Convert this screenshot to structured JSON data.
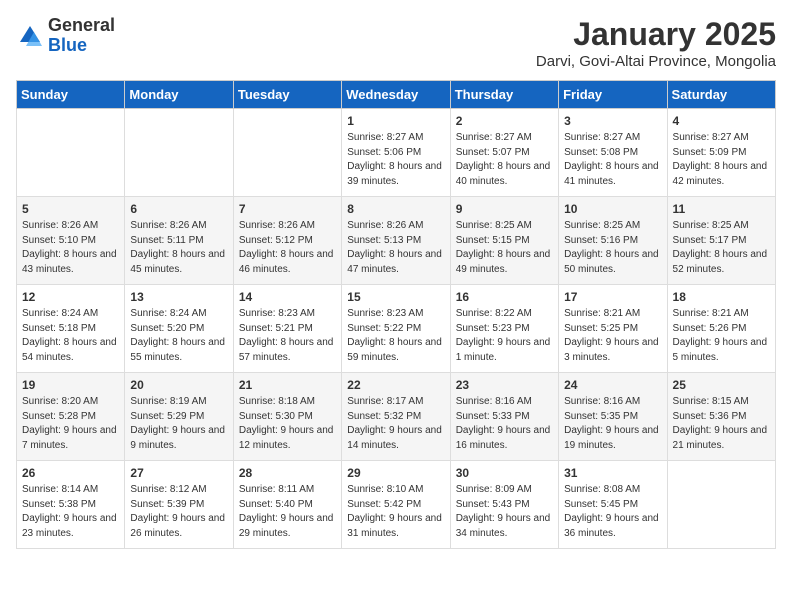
{
  "logo": {
    "general": "General",
    "blue": "Blue"
  },
  "title": "January 2025",
  "location": "Darvi, Govi-Altai Province, Mongolia",
  "headers": [
    "Sunday",
    "Monday",
    "Tuesday",
    "Wednesday",
    "Thursday",
    "Friday",
    "Saturday"
  ],
  "weeks": [
    [
      {
        "day": "",
        "info": ""
      },
      {
        "day": "",
        "info": ""
      },
      {
        "day": "",
        "info": ""
      },
      {
        "day": "1",
        "info": "Sunrise: 8:27 AM\nSunset: 5:06 PM\nDaylight: 8 hours and 39 minutes."
      },
      {
        "day": "2",
        "info": "Sunrise: 8:27 AM\nSunset: 5:07 PM\nDaylight: 8 hours and 40 minutes."
      },
      {
        "day": "3",
        "info": "Sunrise: 8:27 AM\nSunset: 5:08 PM\nDaylight: 8 hours and 41 minutes."
      },
      {
        "day": "4",
        "info": "Sunrise: 8:27 AM\nSunset: 5:09 PM\nDaylight: 8 hours and 42 minutes."
      }
    ],
    [
      {
        "day": "5",
        "info": "Sunrise: 8:26 AM\nSunset: 5:10 PM\nDaylight: 8 hours and 43 minutes."
      },
      {
        "day": "6",
        "info": "Sunrise: 8:26 AM\nSunset: 5:11 PM\nDaylight: 8 hours and 45 minutes."
      },
      {
        "day": "7",
        "info": "Sunrise: 8:26 AM\nSunset: 5:12 PM\nDaylight: 8 hours and 46 minutes."
      },
      {
        "day": "8",
        "info": "Sunrise: 8:26 AM\nSunset: 5:13 PM\nDaylight: 8 hours and 47 minutes."
      },
      {
        "day": "9",
        "info": "Sunrise: 8:25 AM\nSunset: 5:15 PM\nDaylight: 8 hours and 49 minutes."
      },
      {
        "day": "10",
        "info": "Sunrise: 8:25 AM\nSunset: 5:16 PM\nDaylight: 8 hours and 50 minutes."
      },
      {
        "day": "11",
        "info": "Sunrise: 8:25 AM\nSunset: 5:17 PM\nDaylight: 8 hours and 52 minutes."
      }
    ],
    [
      {
        "day": "12",
        "info": "Sunrise: 8:24 AM\nSunset: 5:18 PM\nDaylight: 8 hours and 54 minutes."
      },
      {
        "day": "13",
        "info": "Sunrise: 8:24 AM\nSunset: 5:20 PM\nDaylight: 8 hours and 55 minutes."
      },
      {
        "day": "14",
        "info": "Sunrise: 8:23 AM\nSunset: 5:21 PM\nDaylight: 8 hours and 57 minutes."
      },
      {
        "day": "15",
        "info": "Sunrise: 8:23 AM\nSunset: 5:22 PM\nDaylight: 8 hours and 59 minutes."
      },
      {
        "day": "16",
        "info": "Sunrise: 8:22 AM\nSunset: 5:23 PM\nDaylight: 9 hours and 1 minute."
      },
      {
        "day": "17",
        "info": "Sunrise: 8:21 AM\nSunset: 5:25 PM\nDaylight: 9 hours and 3 minutes."
      },
      {
        "day": "18",
        "info": "Sunrise: 8:21 AM\nSunset: 5:26 PM\nDaylight: 9 hours and 5 minutes."
      }
    ],
    [
      {
        "day": "19",
        "info": "Sunrise: 8:20 AM\nSunset: 5:28 PM\nDaylight: 9 hours and 7 minutes."
      },
      {
        "day": "20",
        "info": "Sunrise: 8:19 AM\nSunset: 5:29 PM\nDaylight: 9 hours and 9 minutes."
      },
      {
        "day": "21",
        "info": "Sunrise: 8:18 AM\nSunset: 5:30 PM\nDaylight: 9 hours and 12 minutes."
      },
      {
        "day": "22",
        "info": "Sunrise: 8:17 AM\nSunset: 5:32 PM\nDaylight: 9 hours and 14 minutes."
      },
      {
        "day": "23",
        "info": "Sunrise: 8:16 AM\nSunset: 5:33 PM\nDaylight: 9 hours and 16 minutes."
      },
      {
        "day": "24",
        "info": "Sunrise: 8:16 AM\nSunset: 5:35 PM\nDaylight: 9 hours and 19 minutes."
      },
      {
        "day": "25",
        "info": "Sunrise: 8:15 AM\nSunset: 5:36 PM\nDaylight: 9 hours and 21 minutes."
      }
    ],
    [
      {
        "day": "26",
        "info": "Sunrise: 8:14 AM\nSunset: 5:38 PM\nDaylight: 9 hours and 23 minutes."
      },
      {
        "day": "27",
        "info": "Sunrise: 8:12 AM\nSunset: 5:39 PM\nDaylight: 9 hours and 26 minutes."
      },
      {
        "day": "28",
        "info": "Sunrise: 8:11 AM\nSunset: 5:40 PM\nDaylight: 9 hours and 29 minutes."
      },
      {
        "day": "29",
        "info": "Sunrise: 8:10 AM\nSunset: 5:42 PM\nDaylight: 9 hours and 31 minutes."
      },
      {
        "day": "30",
        "info": "Sunrise: 8:09 AM\nSunset: 5:43 PM\nDaylight: 9 hours and 34 minutes."
      },
      {
        "day": "31",
        "info": "Sunrise: 8:08 AM\nSunset: 5:45 PM\nDaylight: 9 hours and 36 minutes."
      },
      {
        "day": "",
        "info": ""
      }
    ]
  ]
}
